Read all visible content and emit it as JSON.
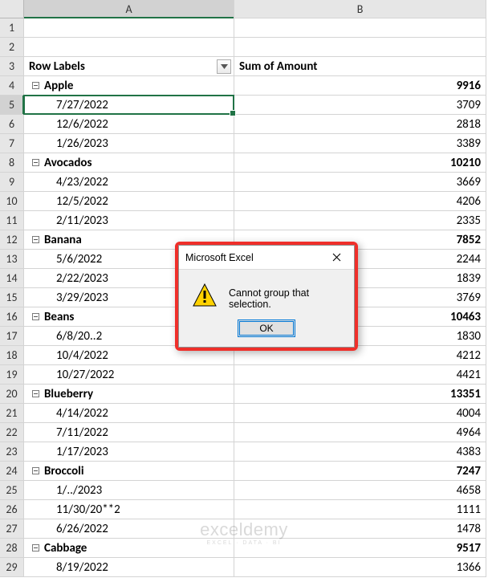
{
  "columns": [
    "A",
    "B"
  ],
  "header": {
    "row_labels": "Row Labels",
    "sum_label": "Sum of Amount"
  },
  "selected": {
    "row": 5,
    "col": "A"
  },
  "rows": [
    {
      "num": 1,
      "type": "blank"
    },
    {
      "num": 2,
      "type": "blank"
    },
    {
      "num": 3,
      "type": "header"
    },
    {
      "num": 4,
      "type": "group",
      "label": "Apple",
      "value": "9916"
    },
    {
      "num": 5,
      "type": "item",
      "label": "7/27/2022",
      "value": "3709"
    },
    {
      "num": 6,
      "type": "item",
      "label": "12/6/2022",
      "value": "2818"
    },
    {
      "num": 7,
      "type": "item",
      "label": "1/26/2023",
      "value": "3389"
    },
    {
      "num": 8,
      "type": "group",
      "label": "Avocados",
      "value": "10210"
    },
    {
      "num": 9,
      "type": "item",
      "label": "4/23/2022",
      "value": "3669"
    },
    {
      "num": 10,
      "type": "item",
      "label": "12/5/2022",
      "value": "4206"
    },
    {
      "num": 11,
      "type": "item",
      "label": "2/11/2023",
      "value": "2335"
    },
    {
      "num": 12,
      "type": "group",
      "label": "Banana",
      "value": "7852"
    },
    {
      "num": 13,
      "type": "item",
      "label": "5/6/2022",
      "value": "2244"
    },
    {
      "num": 14,
      "type": "item",
      "label": "2/22/2023",
      "value": "1839"
    },
    {
      "num": 15,
      "type": "item",
      "label": "3/29/2023",
      "value": "3769"
    },
    {
      "num": 16,
      "type": "group",
      "label": "Beans",
      "value": "10463"
    },
    {
      "num": 17,
      "type": "item",
      "label": "6/8/20..2",
      "value": "1830"
    },
    {
      "num": 18,
      "type": "item",
      "label": "10/4/2022",
      "value": "4212"
    },
    {
      "num": 19,
      "type": "item",
      "label": "10/27/2022",
      "value": "4421"
    },
    {
      "num": 20,
      "type": "group",
      "label": "Blueberry",
      "value": "13351"
    },
    {
      "num": 21,
      "type": "item",
      "label": "4/14/2022",
      "value": "4004"
    },
    {
      "num": 22,
      "type": "item",
      "label": "7/11/2022",
      "value": "4964"
    },
    {
      "num": 23,
      "type": "item",
      "label": "1/17/2023",
      "value": "4383"
    },
    {
      "num": 24,
      "type": "group",
      "label": "Broccoli",
      "value": "7247"
    },
    {
      "num": 25,
      "type": "item",
      "label": "1/../2023",
      "value": "4658"
    },
    {
      "num": 26,
      "type": "item",
      "label": "11/30/20**2",
      "value": "1111"
    },
    {
      "num": 27,
      "type": "item",
      "label": "6/26/2022",
      "value": "1478"
    },
    {
      "num": 28,
      "type": "group",
      "label": "Cabbage",
      "value": "9517"
    },
    {
      "num": 29,
      "type": "item",
      "label": "8/19/2022",
      "value": "1366"
    }
  ],
  "dialog": {
    "title": "Microsoft Excel",
    "message": "Cannot group that selection.",
    "ok": "OK"
  },
  "watermark": {
    "line1": "exceldemy",
    "line2": "EXCEL · DATA · BI"
  }
}
